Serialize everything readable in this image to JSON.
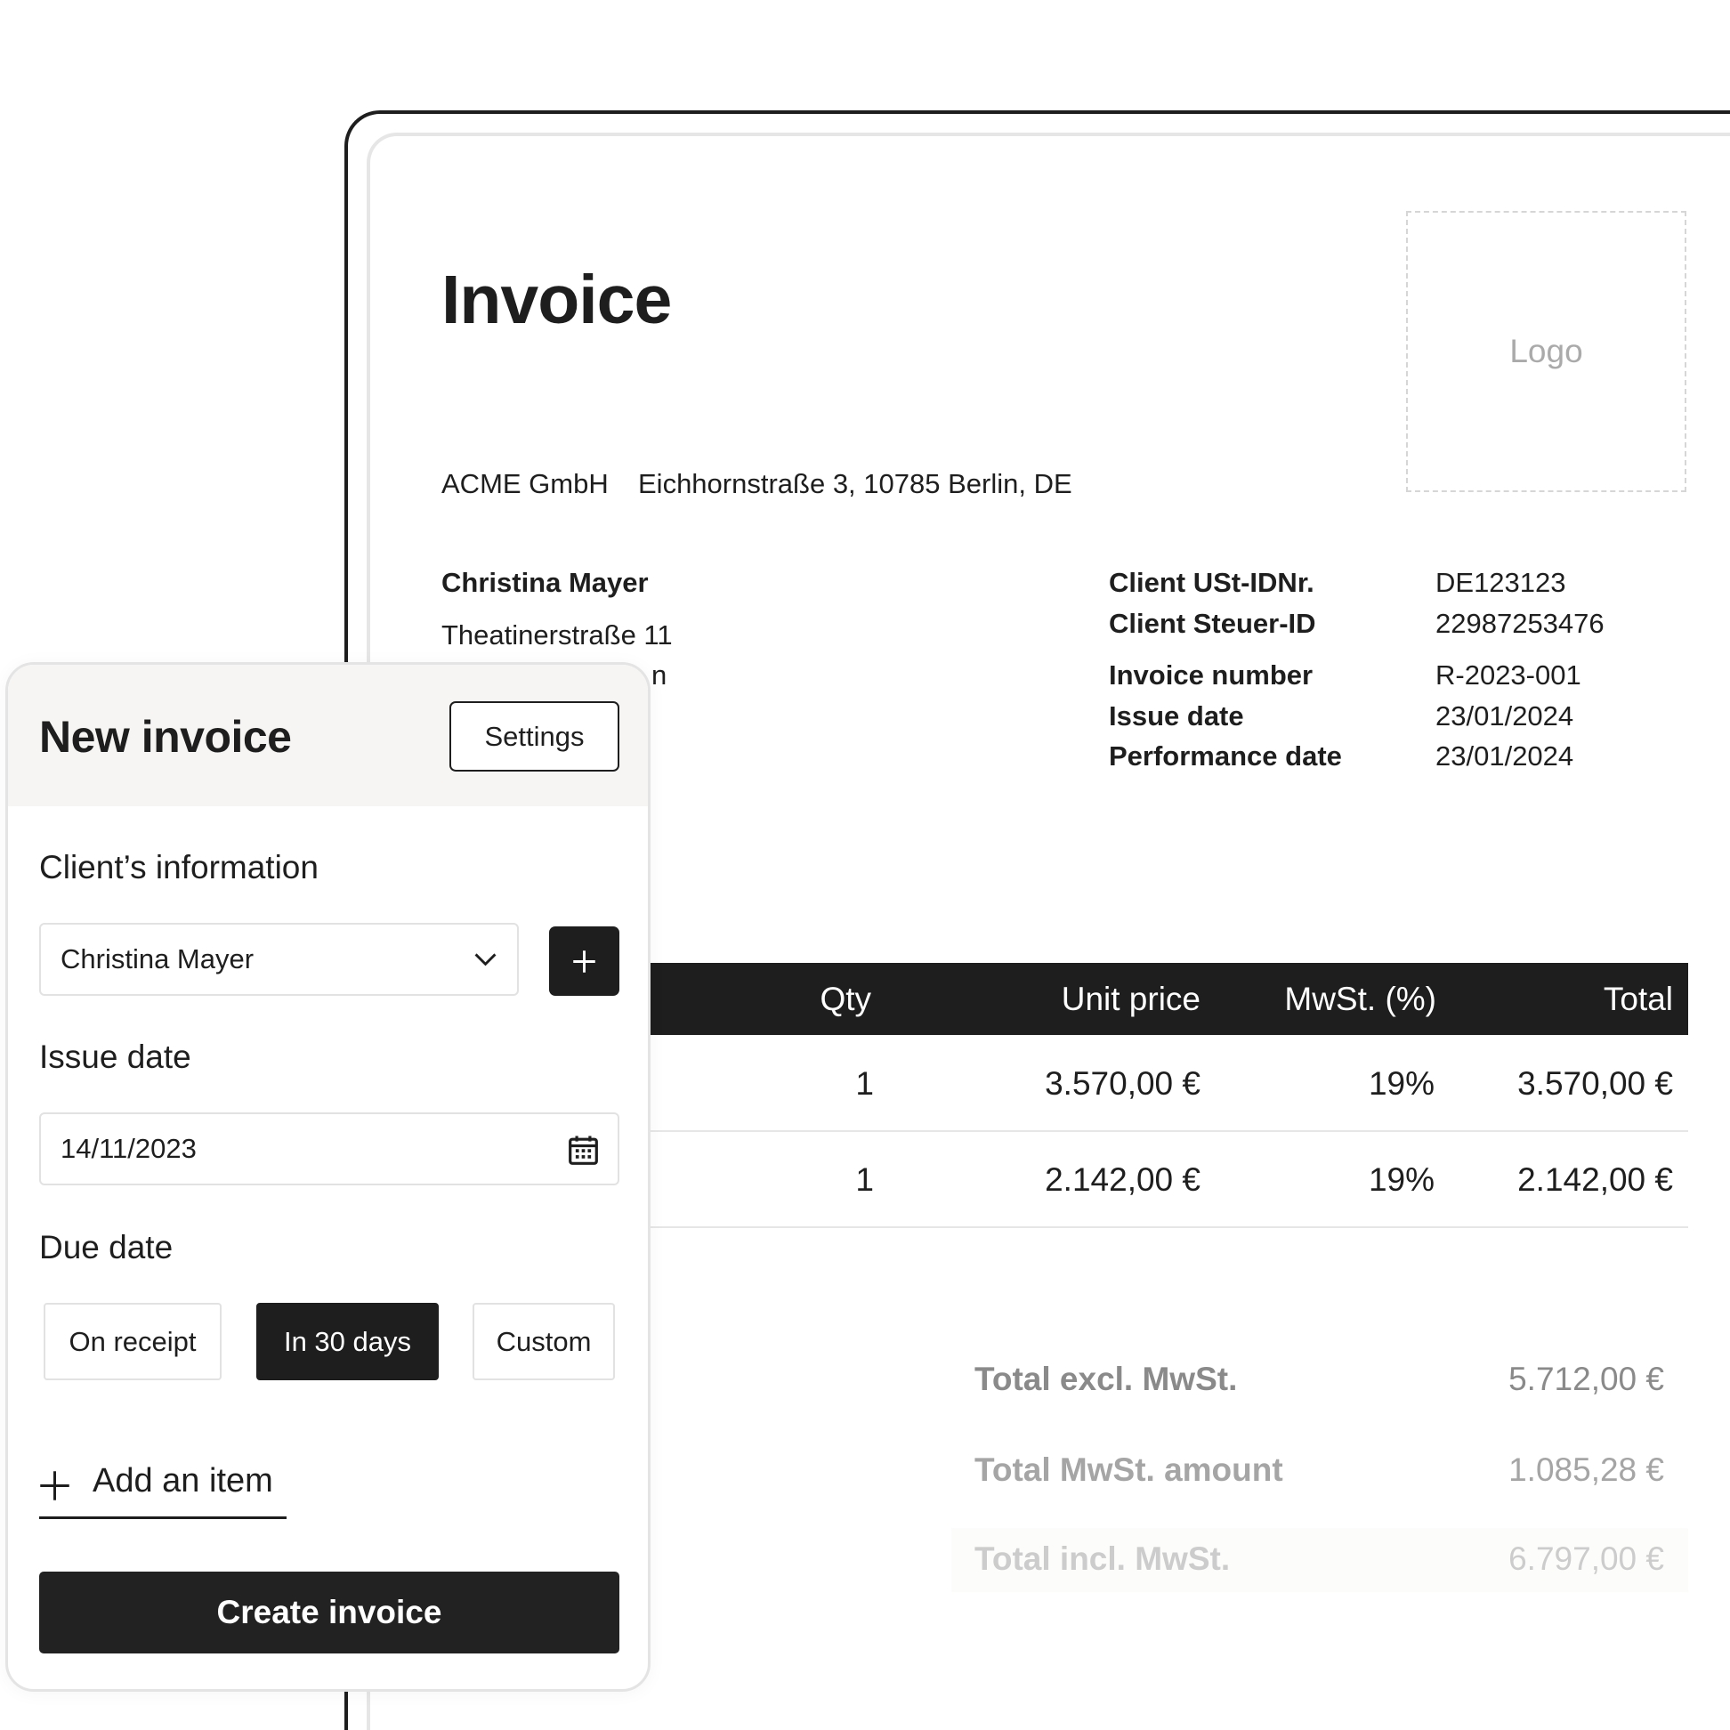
{
  "invoice": {
    "title": "Invoice",
    "logo_placeholder": "Logo",
    "company_name": "ACME GmbH",
    "company_address": "Eichhornstraße 3, 10785 Berlin, DE",
    "client": {
      "name": "Christina Mayer",
      "street": "Theatinerstraße 11",
      "city": "n"
    },
    "details": [
      {
        "label": "Client USt-IDNr.",
        "value": "DE123123"
      },
      {
        "label": "Client Steuer-ID",
        "value": "22987253476"
      },
      {
        "label": "Invoice number",
        "value": "R-2023-001"
      },
      {
        "label": "Issue date",
        "value": "23/01/2024"
      },
      {
        "label": "Performance date",
        "value": "23/01/2024"
      }
    ],
    "table": {
      "headers": {
        "qty": "Qty",
        "unit_price": "Unit price",
        "vat": "MwSt. (%)",
        "total": "Total"
      },
      "rows": [
        {
          "qty": "1",
          "unit_price": "3.570,00 €",
          "vat": "19%",
          "total": "3.570,00 €"
        },
        {
          "qty": "1",
          "unit_price": "2.142,00 €",
          "vat": "19%",
          "total": "2.142,00 €"
        }
      ]
    },
    "totals": [
      {
        "label": "Total excl. MwSt.",
        "value": "5.712,00 €"
      },
      {
        "label": "Total MwSt. amount",
        "value": "1.085,28 €"
      },
      {
        "label": "Total incl. MwSt.",
        "value": "6.797,00 €"
      }
    ]
  },
  "panel": {
    "title": "New invoice",
    "settings_label": "Settings",
    "client_section": "Client’s information",
    "client_selected": "Christina Mayer",
    "issue_date_label": "Issue date",
    "issue_date_value": "14/11/2023",
    "due_date_label": "Due date",
    "due_options": [
      "On receipt",
      "In 30 days",
      "Custom"
    ],
    "due_selected": "In 30 days",
    "add_item_label": "Add an item",
    "create_label": "Create invoice"
  },
  "colors": {
    "dark": "#1e1e1e",
    "panel_header": "#f6f5f3",
    "border": "#e2e2e2"
  }
}
